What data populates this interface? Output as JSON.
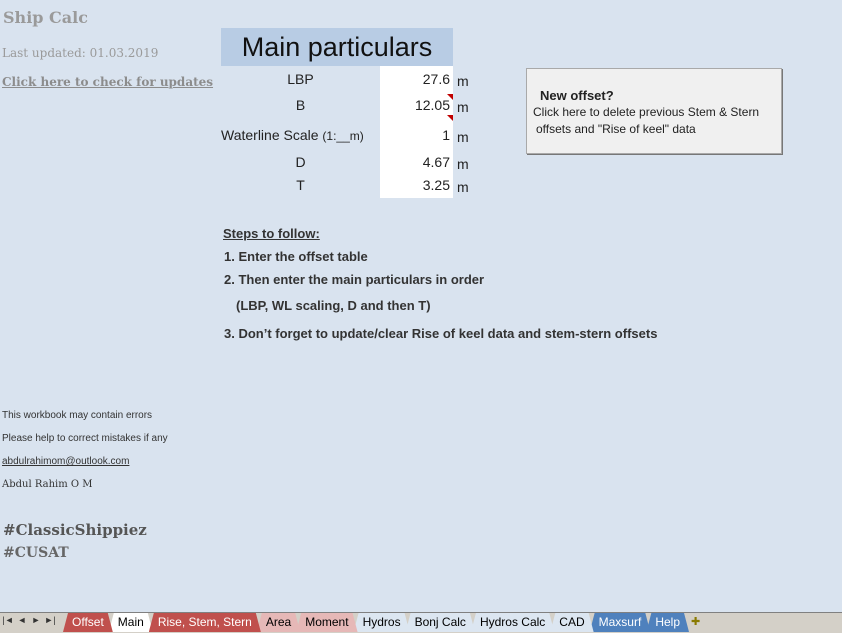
{
  "sheet": {
    "app_title": "Ship Calc",
    "last_updated": "Last updated: 01.03.2019",
    "update_link": "Click here to check for updates"
  },
  "main_particulars": {
    "title": "Main particulars",
    "rows": [
      {
        "label": "LBP",
        "value": "27.6",
        "unit": "m"
      },
      {
        "label": "B",
        "value": "12.05",
        "unit": "m"
      },
      {
        "label": "Waterline Scale",
        "label_suffix": "(1:__m)",
        "value": "1",
        "unit": "m"
      },
      {
        "label": "D",
        "value": "4.67",
        "unit": "m"
      },
      {
        "label": "T",
        "value": "3.25",
        "unit": "m"
      }
    ]
  },
  "new_offset_button": {
    "title": "New offset?",
    "line1": "Click here to delete previous Stem & Stern",
    "line2": "offsets and \"Rise of keel\" data"
  },
  "steps": {
    "title": "Steps to follow:",
    "items": [
      "1. Enter the offset table",
      "2. Then enter the main particulars in order",
      "(LBP, WL scaling, D and then T)",
      "3. Don’t forget to update/clear Rise of keel data and stem-stern offsets"
    ]
  },
  "notes": {
    "line1": "This workbook may contain errors",
    "line2": "Please help to correct mistakes if any",
    "email": "abdulrahimom@outlook.com",
    "author": "Abdul Rahim O M",
    "hashtag1": "#ClassicShippiez",
    "hashtag2": "#CUSAT"
  },
  "sheet_tabs": [
    {
      "label": "Offset",
      "color": "#c0504d",
      "text_color": "#ffffff"
    },
    {
      "label": "Main",
      "color": "#ffffff",
      "text_color": "#000000",
      "active": true
    },
    {
      "label": "Rise, Stem, Stern",
      "color": "#c0504d",
      "text_color": "#ffffff"
    },
    {
      "label": "Area",
      "color": "#e6b8b7",
      "text_color": "#000000"
    },
    {
      "label": "Moment",
      "color": "#e6b8b7",
      "text_color": "#000000"
    },
    {
      "label": "Hydros",
      "color": "#dce6f1",
      "text_color": "#000000"
    },
    {
      "label": "Bonj Calc",
      "color": "#dce6f1",
      "text_color": "#000000"
    },
    {
      "label": "Hydros Calc",
      "color": "#dce6f1",
      "text_color": "#000000"
    },
    {
      "label": "CAD",
      "color": "#dce6f1",
      "text_color": "#000000"
    },
    {
      "label": "Maxsurf",
      "color": "#4f81bd",
      "text_color": "#ffffff"
    },
    {
      "label": "Help",
      "color": "#4f81bd",
      "text_color": "#ffffff"
    }
  ],
  "icons": {
    "nav": [
      "first-sheet-icon",
      "prev-sheet-icon",
      "next-sheet-icon",
      "last-sheet-icon"
    ],
    "add_sheet": "insert-sheet-icon"
  }
}
